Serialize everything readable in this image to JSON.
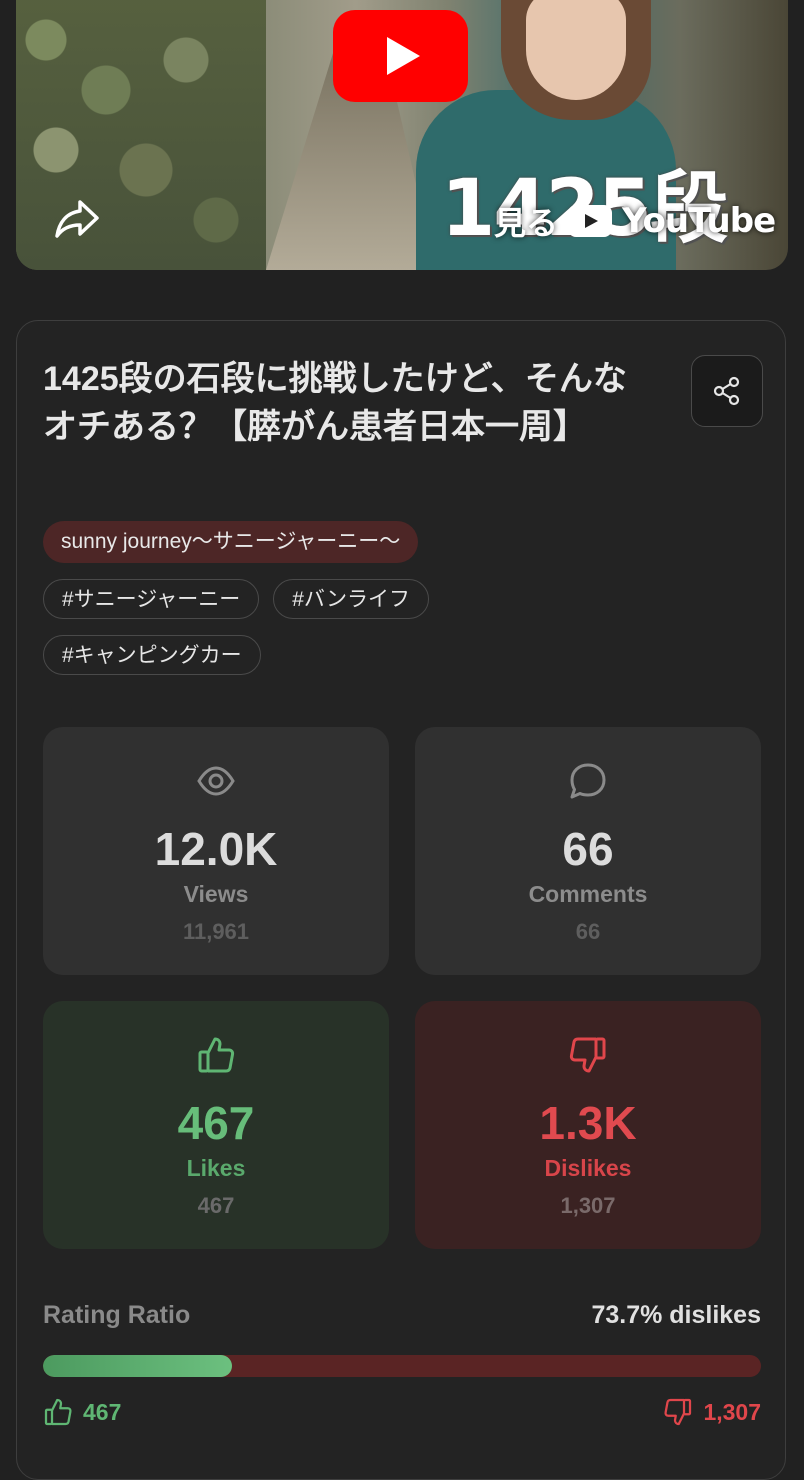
{
  "video": {
    "overlay_text": "1425段",
    "watch_label": "見る",
    "youtube_wordmark": "YouTube"
  },
  "title": "1425段の石段に挑戦したけど、そんなオチある？【膵がん患者日本一周】",
  "channel": "sunny journey〜サニージャーニー〜",
  "tags": [
    "#サニージャーニー",
    "#バンライフ",
    "#キャンピングカー"
  ],
  "stats": {
    "views": {
      "value": "12.0K",
      "label": "Views",
      "exact": "11,961",
      "icon": "eye-icon"
    },
    "comments": {
      "value": "66",
      "label": "Comments",
      "exact": "66",
      "icon": "comment-icon"
    },
    "likes": {
      "value": "467",
      "label": "Likes",
      "exact": "467",
      "icon": "thumbs-up-icon"
    },
    "dislikes": {
      "value": "1.3K",
      "label": "Dislikes",
      "exact": "1,307",
      "icon": "thumbs-down-icon"
    }
  },
  "rating": {
    "label": "Rating Ratio",
    "summary": "73.7% dislikes",
    "like_fraction": 0.263,
    "likes": "467",
    "dislikes": "1,307"
  },
  "colors": {
    "like": "#67bd7a",
    "dislike": "#e04a4f",
    "channel_pill": "#4d2626",
    "youtube_red": "#ff0000"
  }
}
